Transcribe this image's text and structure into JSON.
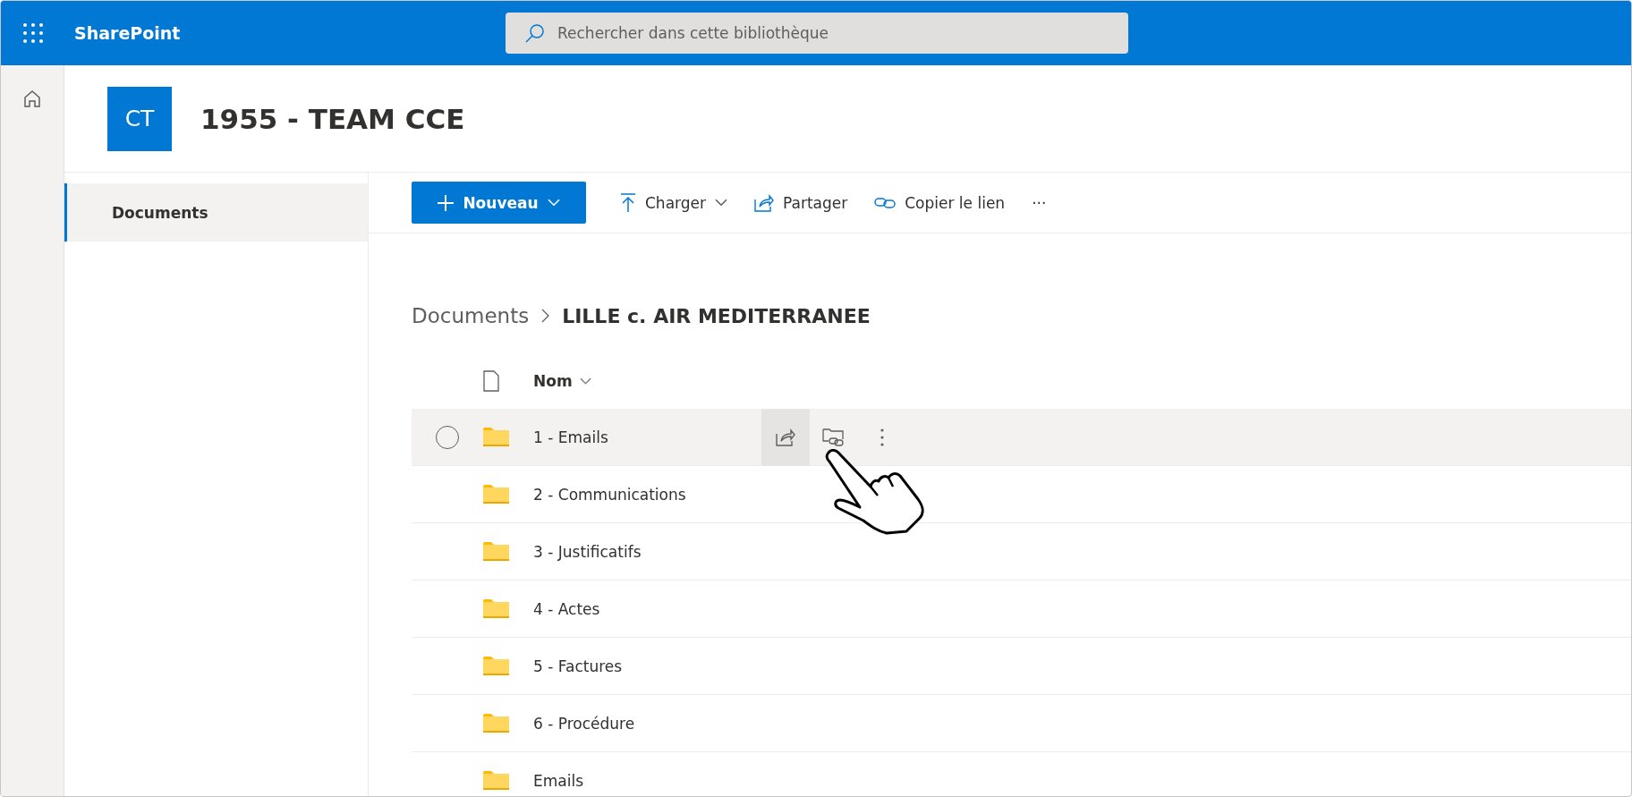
{
  "app_bar": {
    "app_name": "SharePoint",
    "search": {
      "placeholder": "Rechercher dans cette bibliothèque"
    }
  },
  "site": {
    "logo": "CT",
    "title": "1955 - TEAM CCE"
  },
  "nav": {
    "items": [
      {
        "label": "Documents",
        "selected": true
      }
    ]
  },
  "toolbar": {
    "new_button": "Nouveau",
    "actions": [
      {
        "kind": "upload",
        "label": "Charger",
        "dropdown": true
      },
      {
        "kind": "share",
        "label": "Partager",
        "dropdown": false
      },
      {
        "kind": "link",
        "label": "Copier le lien",
        "dropdown": false
      }
    ],
    "more": "···"
  },
  "breadcrumb": {
    "parent": "Documents",
    "current": "LILLE c. AIR MEDITERRANEE"
  },
  "list": {
    "column": "Nom",
    "rows": [
      {
        "name": "1 - Emails",
        "hovered": true
      },
      {
        "name": "2 - Communications",
        "hovered": false
      },
      {
        "name": "3 - Justificatifs",
        "hovered": false
      },
      {
        "name": "4 - Actes",
        "hovered": false
      },
      {
        "name": "5 - Factures",
        "hovered": false
      },
      {
        "name": "6 - Procédure",
        "hovered": false
      },
      {
        "name": "Emails",
        "hovered": false
      }
    ]
  }
}
